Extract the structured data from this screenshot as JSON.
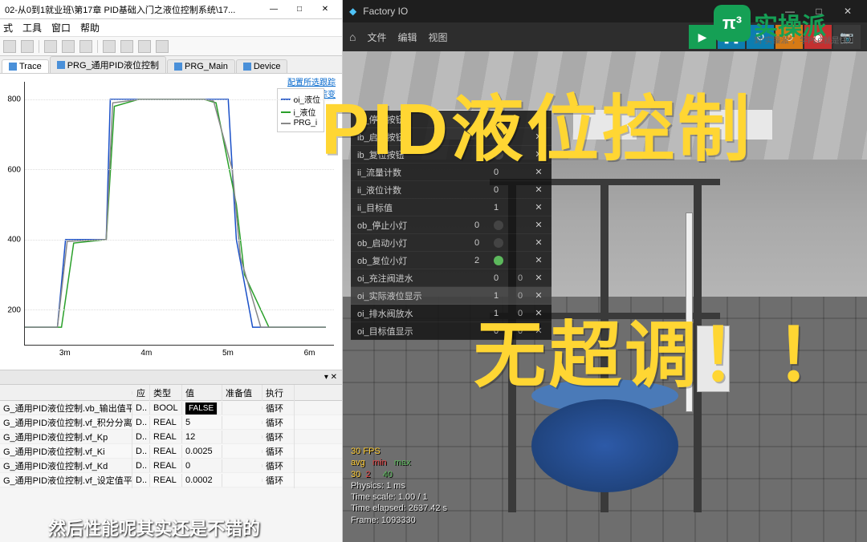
{
  "ide": {
    "title": "02-从0到1就业班\\第17章 PID基础入门之液位控制系统\\17...",
    "menu": [
      "式",
      "工具",
      "窗口",
      "帮助"
    ],
    "tabs": [
      {
        "label": "Trace",
        "active": true
      },
      {
        "label": "PRG_通用PID液位控制"
      },
      {
        "label": "PRG_Main"
      },
      {
        "label": "Device"
      }
    ],
    "chart_links": {
      "line1": "配置所选跟踪",
      "line2": "添加跟踪变"
    },
    "var_table_title": "",
    "var_header": {
      "expr": "",
      "app": "应",
      "type": "类型",
      "val": "值",
      "prep": "准备值",
      "exec": "执行"
    },
    "vars": [
      {
        "expr": "G_通用PID液位控制.vb_输出值平滑",
        "app": "D..",
        "type": "BOOL",
        "val": "FALSE",
        "exec": "循环"
      },
      {
        "expr": "G_通用PID液位控制.vf_积分分离阈值",
        "app": "D..",
        "type": "REAL",
        "val": "5",
        "exec": "循环"
      },
      {
        "expr": "G_通用PID液位控制.vf_Kp",
        "app": "D..",
        "type": "REAL",
        "val": "12",
        "exec": "循环"
      },
      {
        "expr": "G_通用PID液位控制.vf_Ki",
        "app": "D..",
        "type": "REAL",
        "val": "0.0025",
        "exec": "循环"
      },
      {
        "expr": "G_通用PID液位控制.vf_Kd",
        "app": "D..",
        "type": "REAL",
        "val": "0",
        "exec": "循环"
      },
      {
        "expr": "G_通用PID液位控制.vf_设定值平滑...",
        "app": "D..",
        "type": "REAL",
        "val": "0.0002",
        "exec": "循环"
      }
    ]
  },
  "chart_data": {
    "type": "line",
    "xlabel": "",
    "ylabel": "",
    "x_ticks": [
      "3m",
      "4m",
      "5m",
      "6m"
    ],
    "y_ticks": [
      200,
      400,
      600,
      800
    ],
    "ylim": [
      100,
      850
    ],
    "series": [
      {
        "name": "oi_液位",
        "color": "#1a50c8",
        "x": [
          2.5,
          2.9,
          3.0,
          3.5,
          3.55,
          3.9,
          4.0,
          4.7,
          4.8,
          5.0,
          5.1,
          5.3,
          6.2
        ],
        "y": [
          150,
          150,
          400,
          400,
          800,
          800,
          800,
          800,
          800,
          800,
          400,
          150,
          150
        ]
      },
      {
        "name": "i_液位",
        "color": "#2aa02a",
        "x": [
          2.5,
          2.95,
          3.1,
          3.5,
          3.6,
          3.9,
          4.1,
          4.7,
          4.85,
          5.1,
          5.2,
          5.5,
          6.2
        ],
        "y": [
          150,
          150,
          390,
          400,
          780,
          800,
          800,
          800,
          790,
          500,
          300,
          150,
          150
        ]
      },
      {
        "name": "PRG_i",
        "color": "#888888",
        "x": [
          2.5,
          2.9,
          3.02,
          3.5,
          3.58,
          3.92,
          4.02,
          4.7,
          4.82,
          5.05,
          5.15,
          5.4,
          6.2
        ],
        "y": [
          150,
          150,
          395,
          400,
          790,
          800,
          800,
          800,
          795,
          600,
          350,
          150,
          150
        ]
      }
    ]
  },
  "factory": {
    "title": "Factory IO",
    "menu": [
      "文件",
      "编辑",
      "视图"
    ],
    "overlay_vars": [
      {
        "name": "ib_停止按钮",
        "val": "",
        "ind": false
      },
      {
        "name": "ib_启动按钮",
        "val": "",
        "ind": false
      },
      {
        "name": "ib_复位按钮",
        "val": "",
        "ind": false
      },
      {
        "name": "ii_流量计数",
        "val": "0",
        "ind": null
      },
      {
        "name": "ii_液位计数",
        "val": "0",
        "ind": null
      },
      {
        "name": "ii_目标值",
        "val": "1",
        "ind": null
      },
      {
        "name": "ob_停止小灯",
        "val": "0",
        "ind": false
      },
      {
        "name": "ob_启动小灯",
        "val": "0",
        "ind": false
      },
      {
        "name": "ob_复位小灯",
        "val": "2",
        "ind": true
      },
      {
        "name": "oi_充注阀进水",
        "val": "0",
        "val2": "0"
      },
      {
        "name": "oi_实际液位显示",
        "val": "1",
        "val2": "0",
        "hl": true
      },
      {
        "name": "oi_排水阀放水",
        "val": "1",
        "val2": "0"
      },
      {
        "name": "oi_目标值显示",
        "val": "0",
        "val2": "0"
      }
    ],
    "stats": {
      "fps": "30 FPS",
      "head": "avg   min   max",
      "nums": "30  2     40",
      "physics": "Physics:      1 ms",
      "timescale": "Time scale:   1.00 / 1",
      "elapsed": "Time elapsed: 2637.42 s",
      "frame": "Frame:        1093330"
    }
  },
  "overlay": {
    "line1": "PID液位控制",
    "line2": "无超调！！"
  },
  "brand": {
    "logo": "π³",
    "text": "实操派",
    "sub": "到\"实操派\"，学PLC就是快！"
  },
  "subtitle": "然后性能呢其实还是不错的"
}
